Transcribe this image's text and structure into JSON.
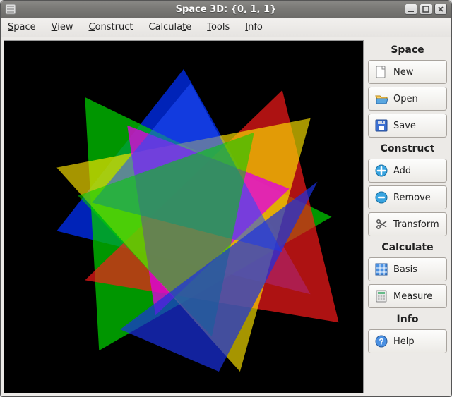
{
  "window": {
    "title": "Space 3D: {0, 1, 1}"
  },
  "menubar": [
    {
      "label": "Space",
      "accel_index": 0
    },
    {
      "label": "View",
      "accel_index": 0
    },
    {
      "label": "Construct",
      "accel_index": 0
    },
    {
      "label": "Calculate",
      "accel_index": 7
    },
    {
      "label": "Tools",
      "accel_index": 0
    },
    {
      "label": "Info",
      "accel_index": 0
    }
  ],
  "sidebar": {
    "sections": [
      {
        "title": "Space",
        "buttons": [
          {
            "name": "new-button",
            "icon": "file-new-icon",
            "label": "New"
          },
          {
            "name": "open-button",
            "icon": "folder-open-icon",
            "label": "Open"
          },
          {
            "name": "save-button",
            "icon": "floppy-save-icon",
            "label": "Save"
          }
        ]
      },
      {
        "title": "Construct",
        "buttons": [
          {
            "name": "add-button",
            "icon": "add-circle-icon",
            "label": "Add"
          },
          {
            "name": "remove-button",
            "icon": "remove-circle-icon",
            "label": "Remove"
          },
          {
            "name": "transform-button",
            "icon": "scissors-icon",
            "label": "Transform"
          }
        ]
      },
      {
        "title": "Calculate",
        "buttons": [
          {
            "name": "basis-button",
            "icon": "grid-icon",
            "label": "Basis"
          },
          {
            "name": "measure-button",
            "icon": "calculator-icon",
            "label": "Measure"
          }
        ]
      },
      {
        "title": "Info",
        "buttons": [
          {
            "name": "help-button",
            "icon": "help-icon",
            "label": "Help"
          }
        ]
      }
    ]
  }
}
